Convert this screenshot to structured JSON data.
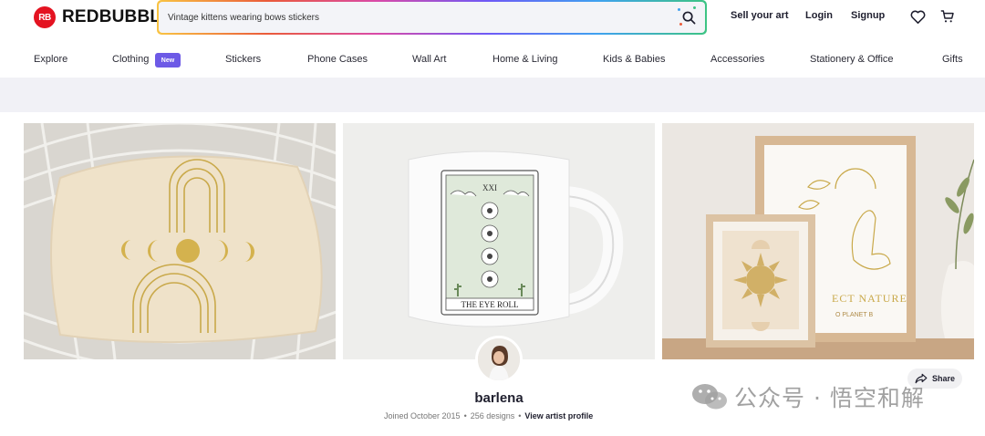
{
  "brand": {
    "logo_mark": "RB",
    "name": "REDBUBBLE",
    "color": "#e41321"
  },
  "search": {
    "value": "Vintage kittens wearing bows stickers",
    "icon": "search-icon"
  },
  "header_links": {
    "sell": "Sell your art",
    "login": "Login",
    "signup": "Signup"
  },
  "header_icons": [
    "heart-icon",
    "cart-icon"
  ],
  "categories": [
    {
      "label": "Explore"
    },
    {
      "label": "Clothing",
      "badge": "New"
    },
    {
      "label": "Stickers"
    },
    {
      "label": "Phone Cases"
    },
    {
      "label": "Wall Art"
    },
    {
      "label": "Home & Living"
    },
    {
      "label": "Kids & Babies"
    },
    {
      "label": "Accessories"
    },
    {
      "label": "Stationery & Office"
    },
    {
      "label": "Gifts"
    }
  ],
  "hero_images": {
    "mug_card": {
      "roman": "XXI",
      "caption": "THE EYE ROLL"
    },
    "frame_text": {
      "line1": "ECT NATURE",
      "line2": "O PLANET B"
    }
  },
  "artist": {
    "name": "barlena",
    "joined": "Joined October 2015",
    "designs": "256 designs",
    "profile_link": "View artist profile",
    "separator": "•"
  },
  "share": {
    "label": "Share",
    "icon": "share-icon"
  },
  "watermark": {
    "text": "公众号 · 悟空和解"
  },
  "colors": {
    "accent_badge": "#6d5ae6",
    "banner": "#f1f1f6"
  }
}
